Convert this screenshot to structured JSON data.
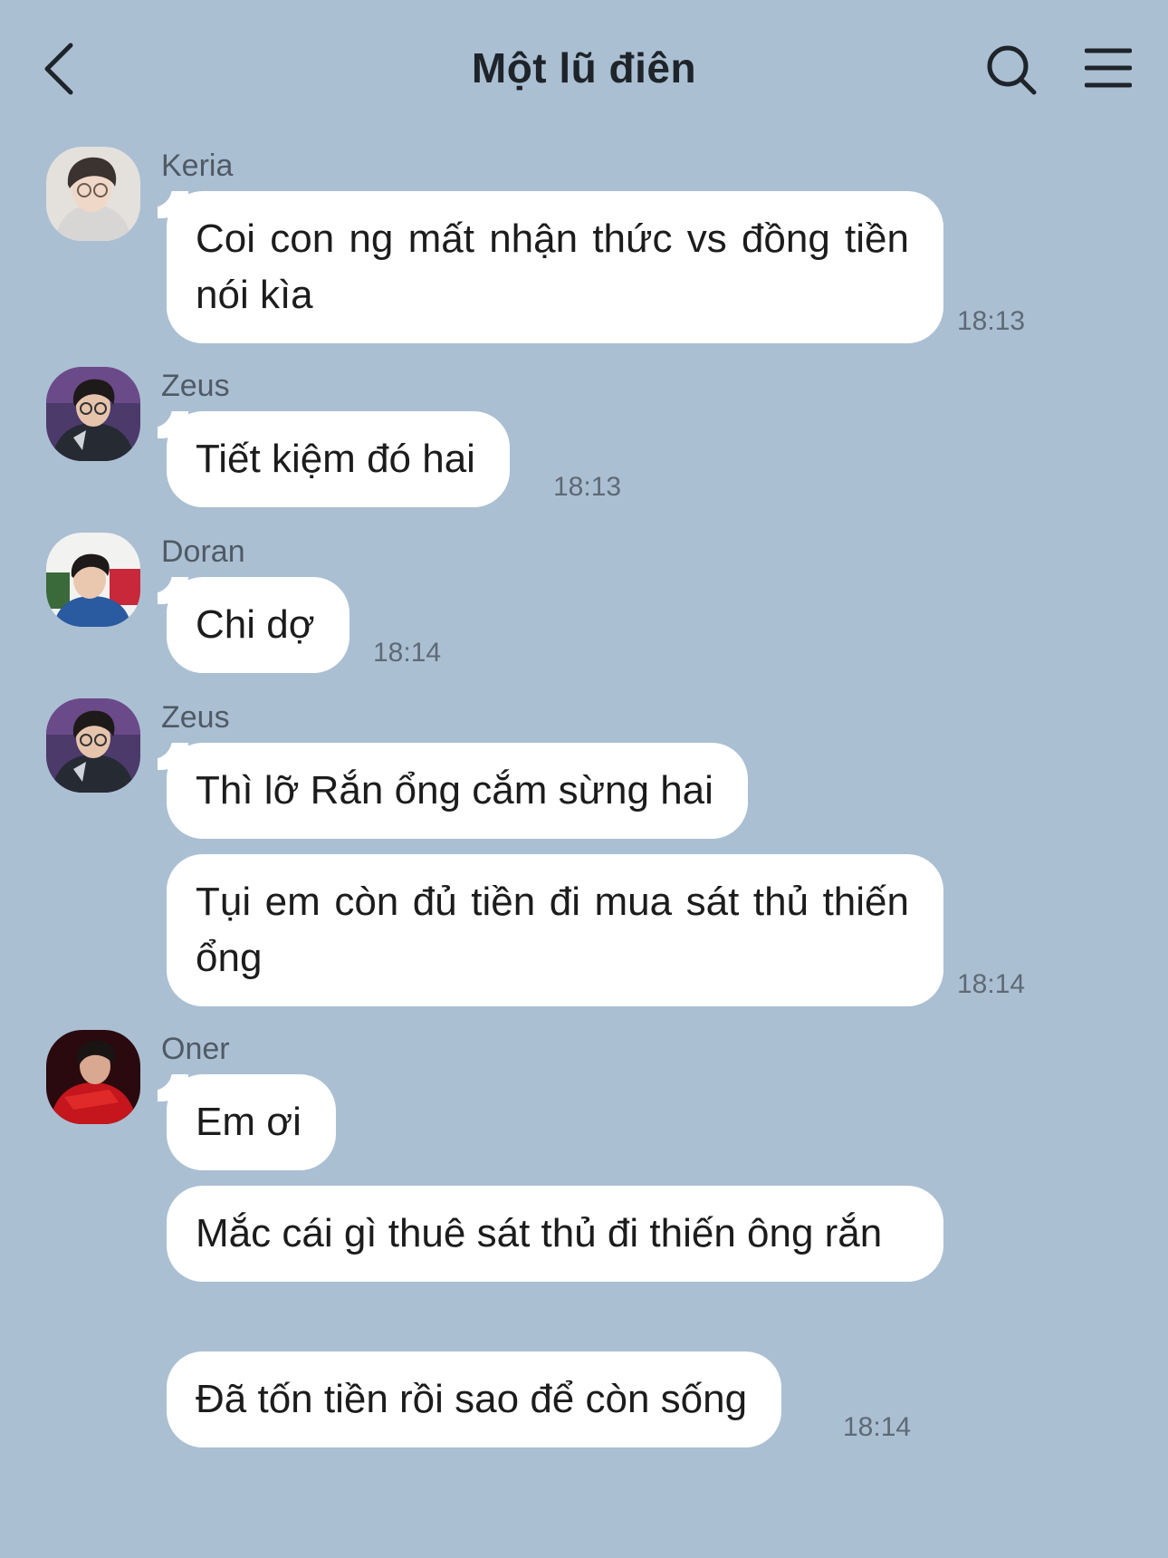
{
  "header": {
    "title": "Một lũ điên",
    "back_icon": "chevron-left-icon",
    "search_icon": "search-icon",
    "menu_icon": "hamburger-menu-icon"
  },
  "messages": [
    {
      "sender": "Keria",
      "text": "Coi con ng mất nhận thức vs đồng tiền nói kìa",
      "time": "18:13"
    },
    {
      "sender": "Zeus",
      "text": "Tiết kiệm đó hai",
      "time": "18:13"
    },
    {
      "sender": "Doran",
      "text": "Chi dợ",
      "time": "18:14"
    },
    {
      "sender": "Zeus",
      "text": "Thì lỡ Rắn ổng cắm sừng hai"
    },
    {
      "text": "Tụi em còn đủ tiền đi mua sát thủ thiến ổng",
      "time": "18:14"
    },
    {
      "sender": "Oner",
      "text": "Em ơi"
    },
    {
      "text": "Mắc cái gì thuê sát thủ đi thiến ông rắn"
    },
    {
      "text": "Đã tốn tiền rồi sao để còn sống",
      "time": "18:14"
    }
  ],
  "colors": {
    "background": "#abbfd3",
    "bubble": "#ffffff"
  }
}
